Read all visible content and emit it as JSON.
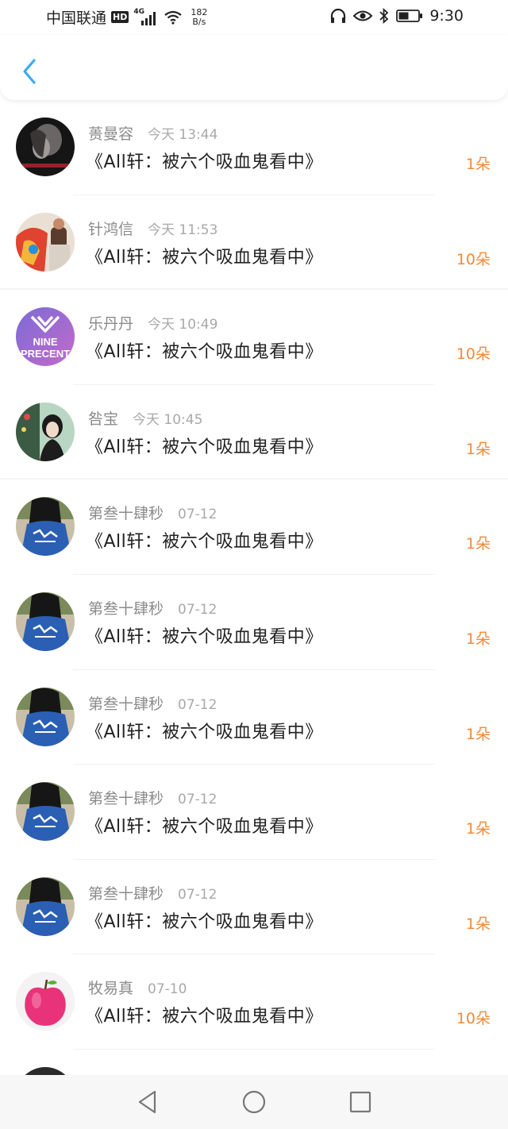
{
  "status_bar": {
    "carrier": "中国联通",
    "hd": "HD",
    "signal_type": "4G",
    "net_speed_value": "182",
    "net_speed_unit": "B/s",
    "time": "9:30",
    "icons": [
      "signal-icon",
      "wifi-icon",
      "headphones-icon",
      "eye-icon",
      "bluetooth-icon",
      "battery-icon"
    ]
  },
  "header": {
    "back_icon": "chevron-left-icon",
    "accent_color": "#3da9f5"
  },
  "colors": {
    "gift_count": "#f08a3c",
    "name": "#8b8b8b",
    "time": "#a9a9a9",
    "title": "#222222"
  },
  "items": [
    {
      "name": "蒉曼容",
      "time": "今天 13:44",
      "title": "《All轩：被六个吸血鬼看中》",
      "count": "1朵",
      "avatar": "avatar-dark-portrait"
    },
    {
      "name": "针鸿信",
      "time": "今天 11:53",
      "title": "《All轩：被六个吸血鬼看中》",
      "count": "10朵",
      "avatar": "avatar-colorful-costume"
    },
    {
      "name": "乐丹丹",
      "time": "今天 10:49",
      "title": "《All轩：被六个吸血鬼看中》",
      "count": "10朵",
      "avatar": "avatar-nine-percent-logo",
      "avatar_text": [
        "NINE",
        "PRECENT"
      ]
    },
    {
      "name": "咎宝",
      "time": "今天 10:45",
      "title": "《All轩：被六个吸血鬼看中》",
      "count": "1朵",
      "avatar": "avatar-girl-green"
    },
    {
      "name": "第叁十肆秒",
      "time": "07-12",
      "title": "《All轩：被六个吸血鬼看中》",
      "count": "1朵",
      "avatar": "avatar-blue-jacket"
    },
    {
      "name": "第叁十肆秒",
      "time": "07-12",
      "title": "《All轩：被六个吸血鬼看中》",
      "count": "1朵",
      "avatar": "avatar-blue-jacket"
    },
    {
      "name": "第叁十肆秒",
      "time": "07-12",
      "title": "《All轩：被六个吸血鬼看中》",
      "count": "1朵",
      "avatar": "avatar-blue-jacket"
    },
    {
      "name": "第叁十肆秒",
      "time": "07-12",
      "title": "《All轩：被六个吸血鬼看中》",
      "count": "1朵",
      "avatar": "avatar-blue-jacket"
    },
    {
      "name": "第叁十肆秒",
      "time": "07-12",
      "title": "《All轩：被六个吸血鬼看中》",
      "count": "1朵",
      "avatar": "avatar-blue-jacket"
    },
    {
      "name": "牧易真",
      "time": "07-10",
      "title": "《All轩：被六个吸血鬼看中》",
      "count": "10朵",
      "avatar": "avatar-pink-apple"
    }
  ],
  "nav_bar": {
    "buttons": [
      "back-triangle-icon",
      "home-circle-icon",
      "recents-square-icon"
    ]
  }
}
